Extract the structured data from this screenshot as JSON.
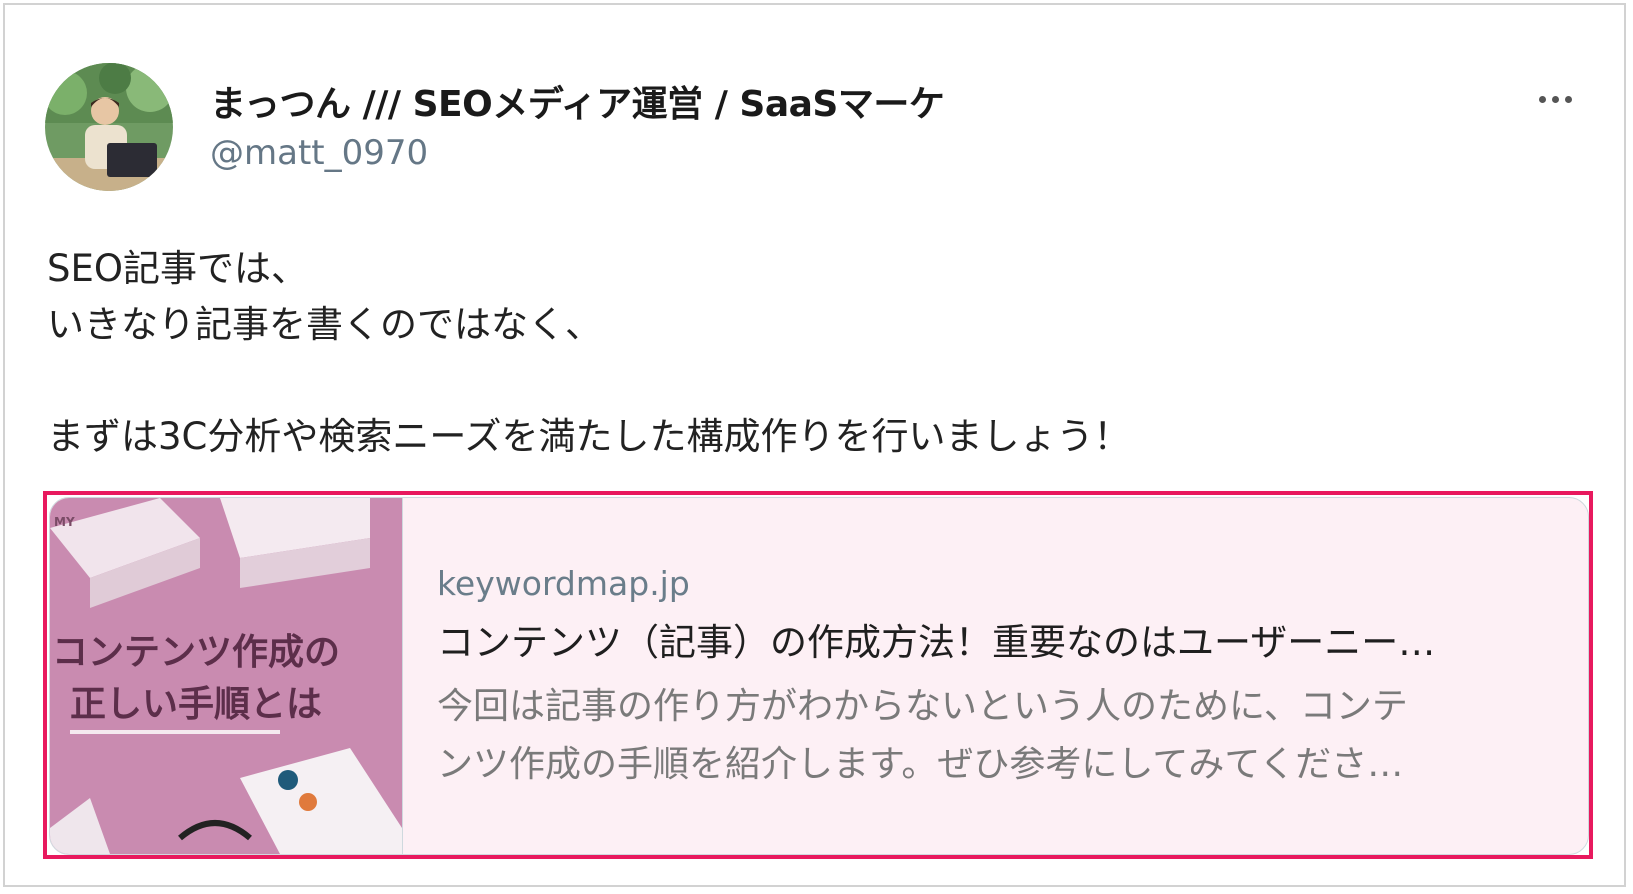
{
  "author": {
    "display_name": "まっつん /// SEOメディア運営 / SaaSマーケ",
    "handle": "@matt_0970"
  },
  "tweet": {
    "text": "SEO記事では、\nいきなり記事を書くのではなく、\n\nまずは3C分析や検索ニーズを満たした構成作りを行いましょう！"
  },
  "card": {
    "domain": "keywordmap.jp",
    "title": "コンテンツ（記事）の作成方法！重要なのはユーザーニー…",
    "description_line1": "今回は記事の作り方がわからないという人のために、コンテ",
    "description_line2": "ンツ作成の手順を紹介します。ぜひ参考にしてみてくださ…",
    "thumbnail_text_line1": "コンテンツ作成の",
    "thumbnail_text_line2": "正しい手順とは",
    "thumbnail_bg": "#c98bb0"
  },
  "colors": {
    "highlight_border": "#e8195e",
    "card_bg": "#fdf0f5"
  },
  "icons": {
    "more": "more-horizontal-icon"
  }
}
